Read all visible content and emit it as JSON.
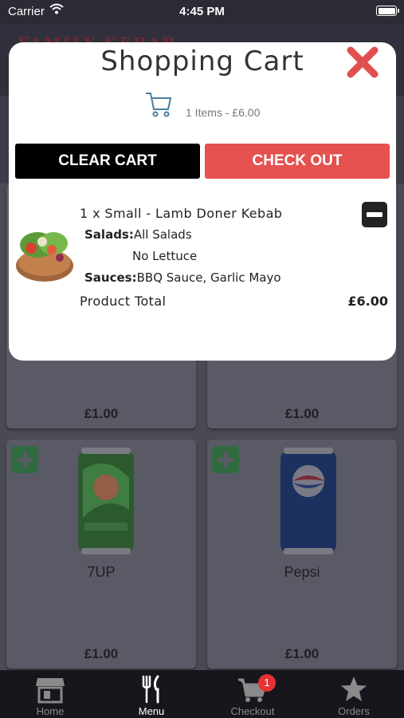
{
  "status_bar": {
    "carrier": "Carrier",
    "time": "4:45 PM"
  },
  "header": {
    "logo_text": "FAMILY KEBAB"
  },
  "modal": {
    "title": "Shopping Cart",
    "summary": "1 Items - £6.00",
    "clear_label": "CLEAR CART",
    "checkout_label": "CHECK OUT",
    "item": {
      "name": "1 x Small - Lamb Doner Kebab",
      "salads_label": "Salads:",
      "salads_value": "All Salads",
      "salads_note": "No Lettuce",
      "sauces_label": "Sauces:",
      "sauces_value": "BBQ Sauce, Garlic Mayo"
    },
    "total_label": "Product Total",
    "total_value": "£6.00"
  },
  "products": [
    {
      "name": "",
      "price": "£1.00"
    },
    {
      "name": "",
      "price": "£1.00"
    },
    {
      "name": "7UP",
      "price": "£1.00"
    },
    {
      "name": "Pepsi",
      "price": "£1.00"
    }
  ],
  "tabbar": {
    "tabs": [
      {
        "label": "Home",
        "icon": "store-icon"
      },
      {
        "label": "Menu",
        "icon": "cutlery-icon"
      },
      {
        "label": "Checkout",
        "icon": "cart-icon",
        "badge": "1"
      },
      {
        "label": "Orders",
        "icon": "star-icon"
      }
    ],
    "active": "Menu"
  },
  "colors": {
    "accent": "#e4514f",
    "dark": "#000000",
    "badge": "#e53232"
  }
}
